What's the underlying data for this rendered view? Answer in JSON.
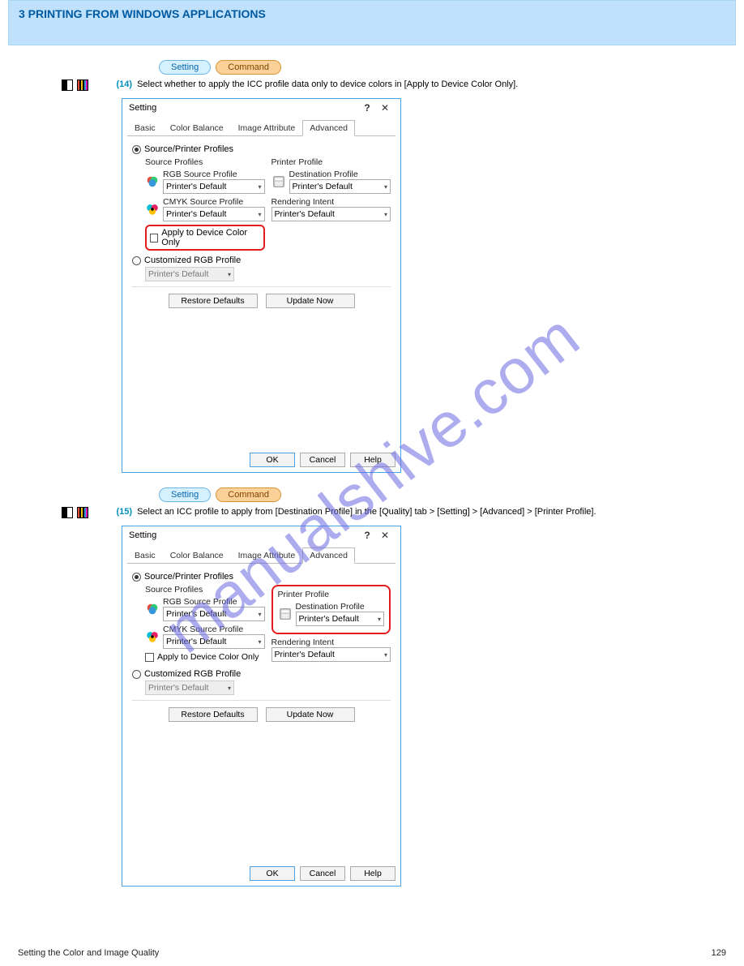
{
  "header": {
    "chapter_label": "3 PRINTING FROM WINDOWS APPLICATIONS"
  },
  "pills": {
    "setting": "Setting",
    "command": "Command"
  },
  "steps": {
    "s14": {
      "num": "(14)",
      "text": "Select whether to apply the ICC profile data only to device colors in [Apply to Device Color Only]."
    },
    "s15": {
      "num": "(15)",
      "text": "Select an ICC profile to apply from [Destination Profile] in the [Quality] tab > [Setting] > [Advanced] > [Printer Profile]."
    }
  },
  "dialog": {
    "title": "Setting",
    "help_glyph": "?",
    "close_glyph": "✕",
    "tabs": {
      "basic": "Basic",
      "color_balance": "Color Balance",
      "image_attribute": "Image Attribute",
      "advanced": "Advanced"
    },
    "radio_source_printer": "Source/Printer Profiles",
    "radio_custom_rgb": "Customized RGB Profile",
    "source_profiles_title": "Source Profiles",
    "printer_profile_title": "Printer Profile",
    "rgb_source_profile": "RGB Source Profile",
    "cmyk_source_profile": "CMYK Source Profile",
    "destination_profile": "Destination Profile",
    "rendering_intent": "Rendering Intent",
    "apply_device_color": "Apply to Device Color Only",
    "default_value": "Printer's Default",
    "restore_defaults": "Restore Defaults",
    "update_now": "Update Now",
    "ok": "OK",
    "cancel": "Cancel",
    "help": "Help"
  },
  "footer": {
    "page_num": "129",
    "left_label": "Setting the Color and Image Quality"
  },
  "watermark": "manualshive.com",
  "icons": {
    "rgb": "rgb-circles-icon",
    "cmyk": "cmyk-circles-icon",
    "printer": "printer-icon",
    "chevron": "chevron-down-icon"
  }
}
